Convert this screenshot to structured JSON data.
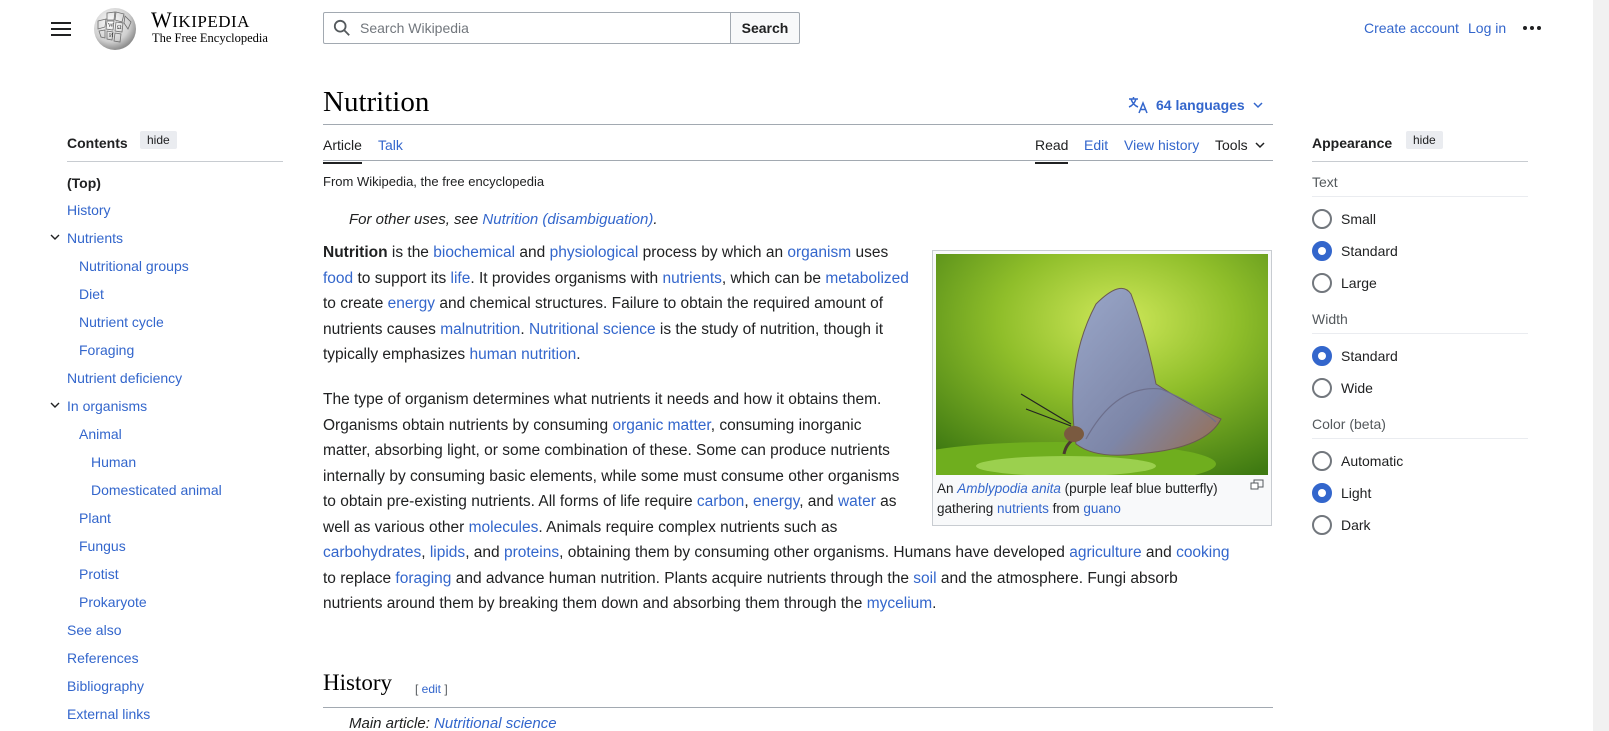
{
  "header": {
    "menu_icon": "hamburger-icon",
    "wordmark_big": "W",
    "wordmark_rest": "IKIPEDIA",
    "tagline": "The Free Encyclopedia",
    "search_placeholder": "Search Wikipedia",
    "search_button": "Search",
    "create_account": "Create account",
    "login": "Log in",
    "more_icon": "ellipsis-icon"
  },
  "toc": {
    "title": "Contents",
    "hide": "hide",
    "top": "(Top)",
    "items": [
      {
        "label": "History"
      },
      {
        "label": "Nutrients"
      },
      {
        "label": "Nutritional groups"
      },
      {
        "label": "Diet"
      },
      {
        "label": "Nutrient cycle"
      },
      {
        "label": "Foraging"
      },
      {
        "label": "Nutrient deficiency"
      },
      {
        "label": "In organisms"
      },
      {
        "label": "Animal"
      },
      {
        "label": "Human"
      },
      {
        "label": "Domesticated animal"
      },
      {
        "label": "Plant"
      },
      {
        "label": "Fungus"
      },
      {
        "label": "Protist"
      },
      {
        "label": "Prokaryote"
      },
      {
        "label": "See also"
      },
      {
        "label": "References"
      },
      {
        "label": "Bibliography"
      },
      {
        "label": "External links"
      }
    ]
  },
  "article": {
    "title": "Nutrition",
    "languages": "64 languages",
    "tabs_left": [
      "Article",
      "Talk"
    ],
    "tabs_right": [
      "Read",
      "Edit",
      "View history",
      "Tools"
    ],
    "from": "From Wikipedia, the free encyclopedia",
    "hatnote_prefix": "For other uses, see ",
    "hatnote_link": "Nutrition (disambiguation)",
    "hatnote_suffix": ".",
    "p1": {
      "bold": "Nutrition",
      "t1": " is the ",
      "l1": "biochemical",
      "t2": " and ",
      "l2": "physiological",
      "t3": " process by which an ",
      "l3": "organism",
      "t4": " uses ",
      "l4": "food",
      "t5": " to support its ",
      "l5": "life",
      "t6": ". It provides organisms with ",
      "l6": "nutrients",
      "t7": ", which can be ",
      "l7": "metabolized",
      "t8": " to create ",
      "l8": "energy",
      "t9": " and chemical structures. Failure to obtain the required amount of nutrients causes ",
      "l9": "malnutrition",
      "t10": ". ",
      "l10": "Nutritional science",
      "t11": " is the study of nutrition, though it typically emphasizes ",
      "l11": "human nutrition",
      "t12": "."
    },
    "p2": {
      "t1": "The type of organism determines what nutrients it needs and how it obtains them. Organisms obtain nutrients by consuming ",
      "l1": "organic matter",
      "t2": ", consuming inorganic matter, absorbing light, or some combination of these. Some can produce nutrients internally by consuming basic elements, while some must consume other organisms to obtain pre-existing nutrients. All forms of life require ",
      "l2": "carbon",
      "t3": ", ",
      "l3": "energy",
      "t4": ", and ",
      "l4": "water",
      "t5": " as well as various other ",
      "l5": "molecules",
      "t6": ". Animals require complex nutrients such as ",
      "l6": "carbohydrates",
      "t7": ", ",
      "l7": "lipids",
      "t8": ", and ",
      "l8": "proteins",
      "t9": ", obtaining them by consuming other organisms. Humans have developed ",
      "l9": "agriculture",
      "t10": " and ",
      "l10": "cooking",
      "t11": " to replace ",
      "l11": "foraging",
      "t12": " and advance human nutrition. Plants acquire nutrients through the ",
      "l12": "soil",
      "t13": " and the atmosphere. Fungi absorb nutrients around them by breaking them down and absorbing them through the ",
      "l13": "mycelium",
      "t14": "."
    },
    "caption": {
      "t1": "An ",
      "l1": "Amblypodia anita",
      "t2": " (purple leaf blue butterfly) gathering ",
      "l2": "nutrients",
      "t3": " from ",
      "l3": "guano"
    },
    "history_heading": "History",
    "edit_open": "[ ",
    "edit_link": "edit",
    "edit_close": " ]",
    "main_article_prefix": "Main article: ",
    "main_article_link": "Nutritional science"
  },
  "appearance": {
    "title": "Appearance",
    "hide": "hide",
    "text_label": "Text",
    "text_options": [
      "Small",
      "Standard",
      "Large"
    ],
    "text_selected": "Standard",
    "width_label": "Width",
    "width_options": [
      "Standard",
      "Wide"
    ],
    "width_selected": "Standard",
    "color_label": "Color (beta)",
    "color_options": [
      "Automatic",
      "Light",
      "Dark"
    ],
    "color_selected": "Light"
  },
  "colors": {
    "link": "#3366cc",
    "text": "#202122",
    "rule": "#a2a9b1"
  }
}
